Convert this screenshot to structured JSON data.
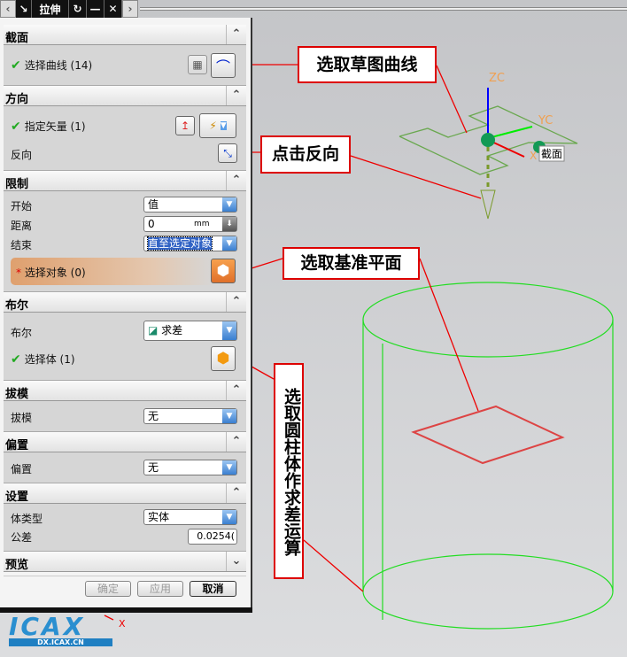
{
  "toolbar": {
    "title": "拉伸",
    "back_icon": "chevron-left-icon",
    "select_icon": "arrow-icon",
    "reset_icon": "undo-icon",
    "min_icon": "minus-icon",
    "close_icon": "close-icon",
    "fwd_icon": "chevron-right-icon"
  },
  "sections": {
    "section": {
      "title": "截面",
      "select_curve": "选择曲线 (14)"
    },
    "direction": {
      "title": "方向",
      "vector": "指定矢量 (1)",
      "reverse": "反向"
    },
    "limits": {
      "title": "限制",
      "start_label": "开始",
      "start_value": "值",
      "distance_label": "距离",
      "distance_value": "0",
      "distance_unit": "mm",
      "end_label": "结束",
      "end_value": "直至选定对象",
      "select_object": "选择对象 (0)"
    },
    "boolean": {
      "title": "布尔",
      "bool_label": "布尔",
      "bool_value": "求差",
      "select_body": "选择体 (1)"
    },
    "draft": {
      "title": "拔模",
      "label": "拔模",
      "value": "无"
    },
    "offset": {
      "title": "偏置",
      "label": "偏置",
      "value": "无"
    },
    "settings": {
      "title": "设置",
      "body_type_label": "体类型",
      "body_type_value": "实体",
      "tolerance_label": "公差",
      "tolerance_value": "0.0254("
    },
    "preview": {
      "title": "预览"
    }
  },
  "buttons": {
    "ok": "确定",
    "apply": "应用",
    "cancel": "取消"
  },
  "callouts": {
    "sketch": "选取草图曲线",
    "reverse": "点击反向",
    "plane": "选取基准平面",
    "cylinder": "选取圆柱体作求差运算"
  },
  "viewport": {
    "zc": "ZC",
    "yc": "YC",
    "x": "X",
    "section_tag": "截面",
    "triad_x": "X"
  },
  "logo": {
    "text": "ICAX",
    "sub": "DX.ICAX.CN"
  },
  "colors": {
    "callout_border": "#dd0000",
    "sketch": "#6aa84f",
    "cylinder": "#22dd22",
    "plane": "#dd4444"
  }
}
